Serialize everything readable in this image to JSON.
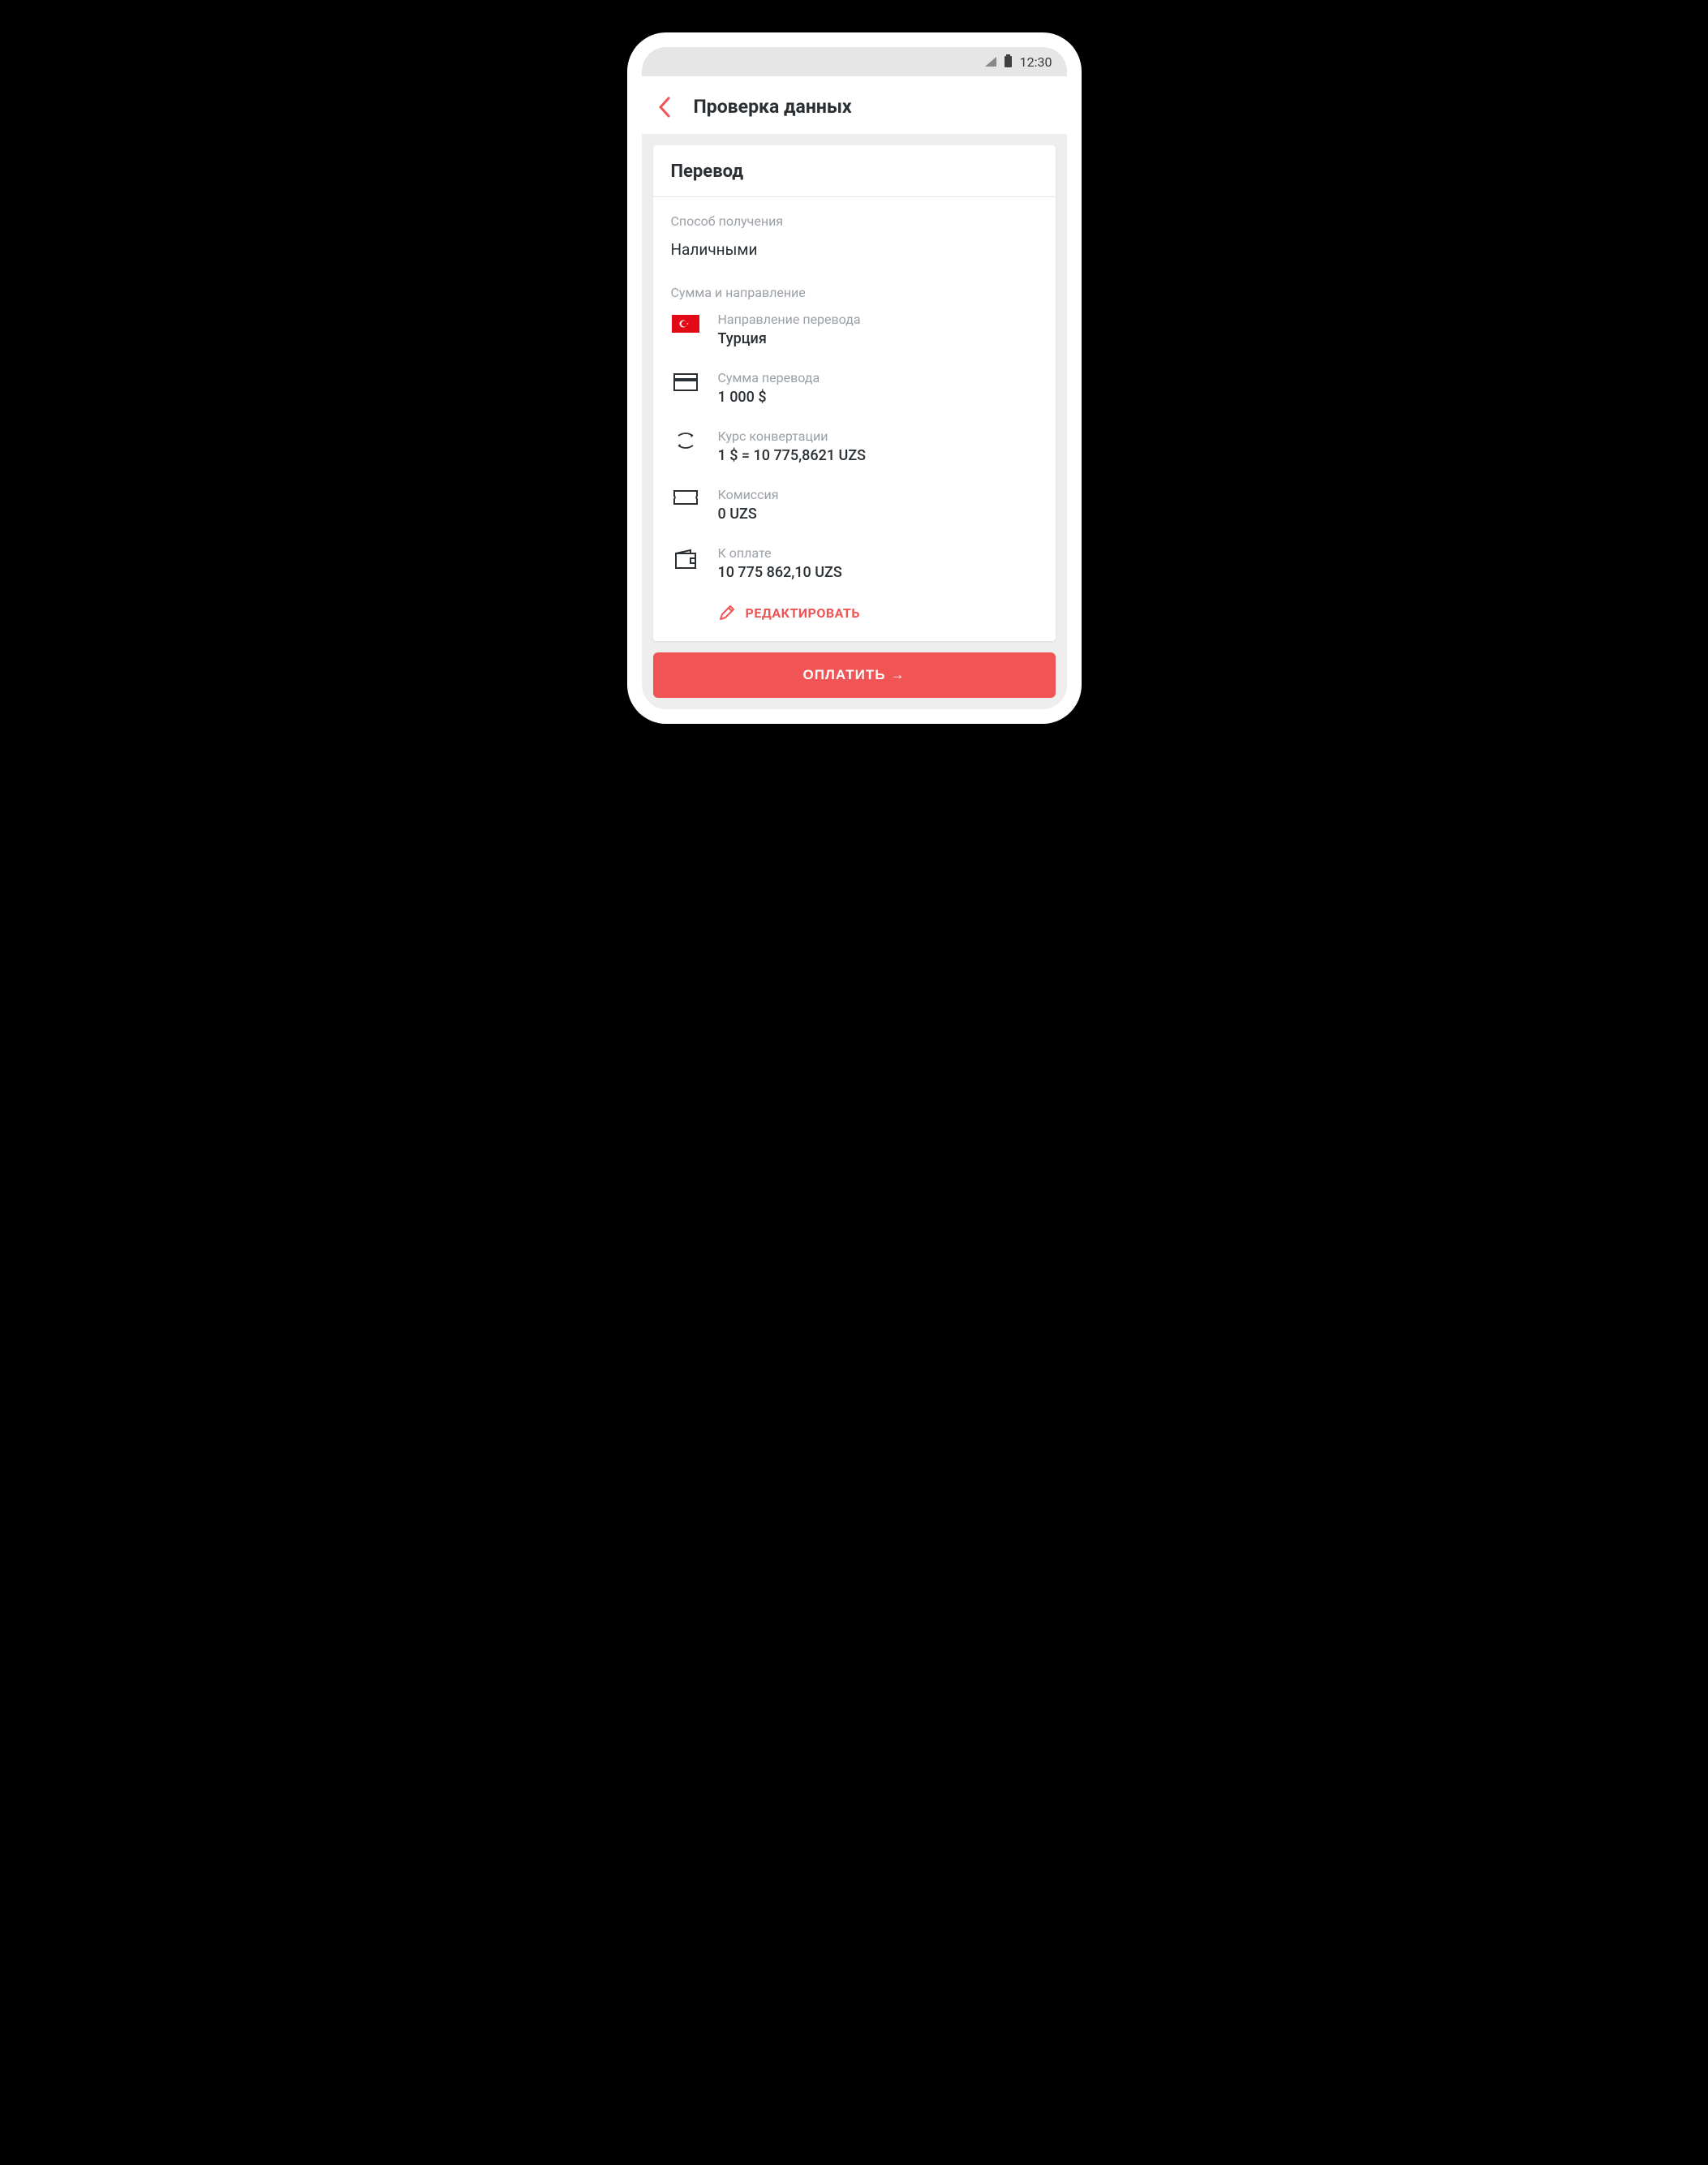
{
  "status_bar": {
    "time": "12:30"
  },
  "header": {
    "title": "Проверка данных"
  },
  "card": {
    "title": "Перевод",
    "method_label": "Способ получения",
    "method_value": "Наличными",
    "amount_section_label": "Сумма и направление",
    "rows": {
      "direction": {
        "label": "Направление перевода",
        "value": "Турция"
      },
      "amount": {
        "label": "Сумма перевода",
        "value": "1 000 $"
      },
      "rate": {
        "label": "Курс конвертации",
        "value": "1 $ = 10 775,8621 UZS"
      },
      "fee": {
        "label": "Комиссия",
        "value": "0 UZS"
      },
      "total": {
        "label": "К оплате",
        "value": "10 775 862,10 UZS"
      }
    },
    "edit_label": "РЕДАКТИРОВАТЬ"
  },
  "pay_button": "ОПЛАТИТЬ"
}
